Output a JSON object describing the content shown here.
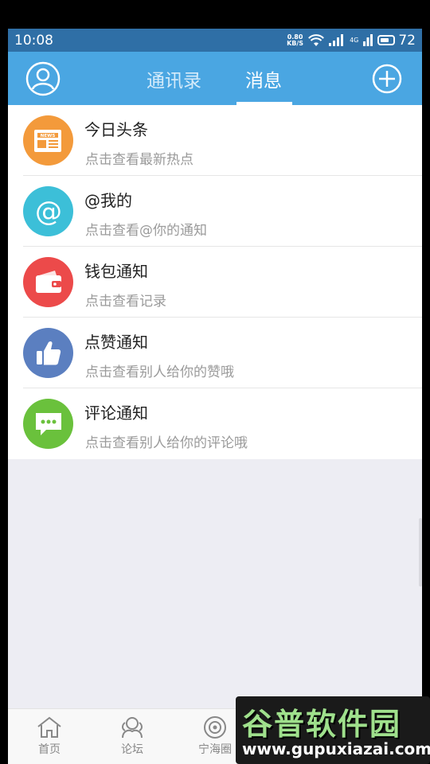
{
  "status_bar": {
    "time": "10:08",
    "net_speed_value": "0.80",
    "net_speed_unit": "KB/S",
    "net_type": "4G",
    "battery": "72"
  },
  "header": {
    "tabs": [
      {
        "label": "通讯录",
        "active": false
      },
      {
        "label": "消息",
        "active": true
      }
    ]
  },
  "messages": [
    {
      "title": "今日头条",
      "subtitle": "点击查看最新热点",
      "icon": "news-icon",
      "color": "#f39a3b",
      "badge": "NEWS"
    },
    {
      "title": "@我的",
      "subtitle": "点击查看@你的通知",
      "icon": "at-icon",
      "color": "#3cbfd8"
    },
    {
      "title": "钱包通知",
      "subtitle": "点击查看记录",
      "icon": "wallet-icon",
      "color": "#ec4a4a"
    },
    {
      "title": "点赞通知",
      "subtitle": "点击查看别人给你的赞哦",
      "icon": "thumbs-up-icon",
      "color": "#5b7fc0"
    },
    {
      "title": "评论通知",
      "subtitle": "点击查看别人给你的评论哦",
      "icon": "comment-icon",
      "color": "#6ac13c"
    }
  ],
  "bottom_nav": [
    {
      "label": "首页",
      "icon": "home-icon"
    },
    {
      "label": "论坛",
      "icon": "forum-icon"
    },
    {
      "label": "宁海圈",
      "icon": "circle-icon"
    }
  ],
  "watermark": {
    "cn": "谷普软件园",
    "url": "www.gupuxiazai.com"
  }
}
